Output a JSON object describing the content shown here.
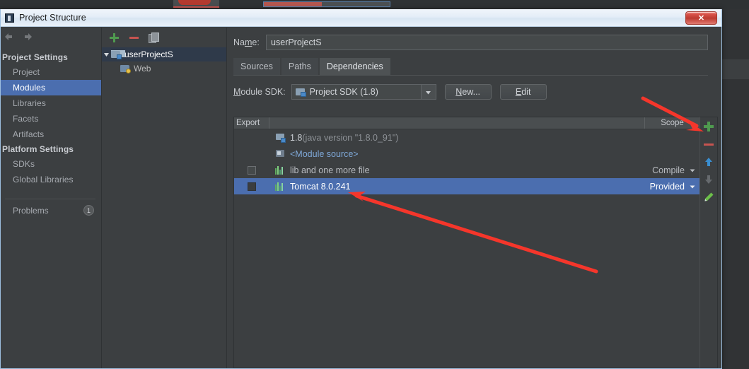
{
  "window": {
    "title": "Project Structure",
    "close_label": "✕",
    "app_icon": "intellij-icon"
  },
  "sidebar": {
    "nav": {
      "back": "back-arrow",
      "forward": "forward-arrow"
    },
    "groups": [
      {
        "label": "Project Settings",
        "items": [
          {
            "label": "Project",
            "selected": false
          },
          {
            "label": "Modules",
            "selected": true
          },
          {
            "label": "Libraries",
            "selected": false
          },
          {
            "label": "Facets",
            "selected": false
          },
          {
            "label": "Artifacts",
            "selected": false
          }
        ]
      },
      {
        "label": "Platform Settings",
        "items": [
          {
            "label": "SDKs",
            "selected": false
          },
          {
            "label": "Global Libraries",
            "selected": false
          }
        ]
      }
    ],
    "problems": {
      "label": "Problems",
      "count": "1"
    }
  },
  "tree": {
    "toolbar": [
      {
        "name": "add-module-button",
        "icon": "plus-icon"
      },
      {
        "name": "remove-module-button",
        "icon": "minus-icon"
      },
      {
        "name": "copy-module-button",
        "icon": "copy-icon"
      }
    ],
    "nodes": [
      {
        "label": "userProjectS",
        "icon": "module-icon",
        "selected": true,
        "expanded": true,
        "depth": 0
      },
      {
        "label": "Web",
        "icon": "facet-web-icon",
        "selected": false,
        "expanded": false,
        "depth": 1
      }
    ]
  },
  "main": {
    "name_label": "Name:",
    "name_value": "userProjectS",
    "tabs": [
      {
        "label": "Sources",
        "active": false
      },
      {
        "label": "Paths",
        "active": false
      },
      {
        "label": "Dependencies",
        "active": true
      }
    ],
    "sdk_label": "Module SDK:",
    "sdk_value": "Project SDK (1.8)",
    "buttons": {
      "new": "New...",
      "edit": "Edit"
    },
    "table": {
      "headers": {
        "export": "Export",
        "middle": "",
        "scope": "Scope"
      },
      "rows": [
        {
          "name": "1.8",
          "suffix": " (java version \"1.8.0_91\")",
          "icon": "jdk-icon",
          "checkbox": false,
          "has_checkbox": false,
          "scope": "",
          "has_scope_caret": false,
          "selected": false,
          "style": "jdk"
        },
        {
          "name": "<Module source>",
          "suffix": "",
          "icon": "module-source-icon",
          "checkbox": false,
          "has_checkbox": false,
          "scope": "",
          "has_scope_caret": false,
          "selected": false,
          "style": "blue"
        },
        {
          "name": "lib and one more file",
          "suffix": "",
          "icon": "library-icon",
          "checkbox": false,
          "has_checkbox": true,
          "scope": "Compile",
          "has_scope_caret": true,
          "selected": false,
          "style": "plain"
        },
        {
          "name": "Tomcat 8.0.241",
          "suffix": "",
          "icon": "library-icon",
          "checkbox": true,
          "has_checkbox": true,
          "scope": "Provided",
          "has_scope_caret": true,
          "selected": true,
          "style": "plain"
        }
      ]
    },
    "side_tools": [
      {
        "name": "add-dependency-button",
        "icon": "plus-icon",
        "enabled": true
      },
      {
        "name": "remove-dependency-button",
        "icon": "minus-icon",
        "enabled": true
      },
      {
        "name": "move-up-button",
        "icon": "arrow-up-icon",
        "enabled": true
      },
      {
        "name": "move-down-button",
        "icon": "arrow-down-icon",
        "enabled": false
      },
      {
        "name": "edit-dependency-button",
        "icon": "pencil-icon",
        "enabled": true
      }
    ]
  },
  "annotations": [
    {
      "name": "arrow-to-add-dependency",
      "color": "#f5362b"
    },
    {
      "name": "arrow-to-tomcat-row",
      "color": "#f5362b"
    }
  ],
  "colors": {
    "selection_blue": "#4b6eaf",
    "panel_bg": "#3c3f41",
    "accent_red": "#f5362b",
    "link_blue": "#7fa8d8",
    "green": "#4f9a4f"
  }
}
